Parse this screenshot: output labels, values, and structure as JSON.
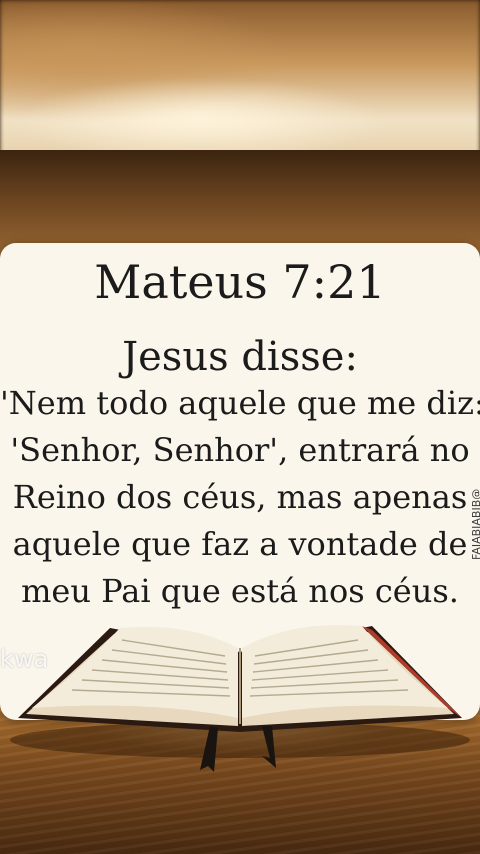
{
  "verse": {
    "reference": "Mateus 7:21",
    "intro": "Jesus disse:",
    "lines": [
      "'Nem todo aquele que me diz:",
      "'Senhor, Senhor', entrará no",
      "Reino dos céus, mas apenas",
      "aquele que faz a vontade de",
      "meu Pai que está nos céus."
    ]
  },
  "watermarks": {
    "left": "kwa",
    "right": "FAIABIABIB@"
  },
  "colors": {
    "card": "#fbf6ec",
    "text": "#1b1b1b",
    "wood": "#9c6a34"
  },
  "icons": [
    "open-bible-icon"
  ]
}
